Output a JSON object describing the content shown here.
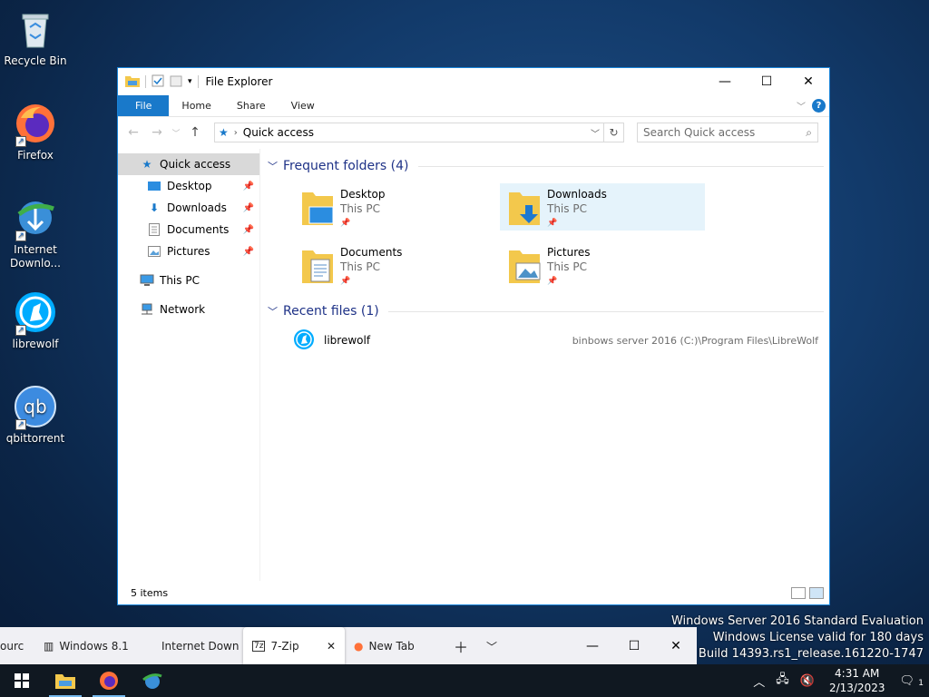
{
  "desktop": {
    "icons": [
      {
        "label": "Recycle Bin"
      },
      {
        "label": "Firefox"
      },
      {
        "label": "Internet Downlo..."
      },
      {
        "label": "librewolf"
      },
      {
        "label": "qbittorrent"
      }
    ]
  },
  "window": {
    "title": "File Explorer",
    "ribbon_tabs": [
      "File",
      "Home",
      "Share",
      "View"
    ],
    "help_label": "?",
    "address": "Quick access",
    "search_placeholder": "Search Quick access",
    "nav": [
      {
        "label": "Quick access",
        "selected": true
      },
      {
        "label": "Desktop",
        "pinned": true
      },
      {
        "label": "Downloads",
        "pinned": true
      },
      {
        "label": "Documents",
        "pinned": true
      },
      {
        "label": "Pictures",
        "pinned": true
      },
      {
        "label": "This PC"
      },
      {
        "label": "Network"
      }
    ],
    "frequent_header": "Frequent folders (4)",
    "folders": [
      {
        "name": "Desktop",
        "location": "This PC"
      },
      {
        "name": "Downloads",
        "location": "This PC",
        "selected": true
      },
      {
        "name": "Documents",
        "location": "This PC"
      },
      {
        "name": "Pictures",
        "location": "This PC"
      }
    ],
    "recent_header": "Recent files (1)",
    "recent_files": [
      {
        "name": "librewolf",
        "path": "binbows server 2016 (C:)\\Program Files\\LibreWolf"
      }
    ],
    "status": "5 items"
  },
  "watermark": {
    "line1": "Windows Server 2016 Standard Evaluation",
    "line2": "Windows License valid for 180 days",
    "line3": "Build 14393.rs1_release.161220-1747"
  },
  "firefox_strip": {
    "tabs": [
      {
        "label": "ourc"
      },
      {
        "label": "Windows 8.1"
      },
      {
        "label": "Internet Down"
      },
      {
        "label": "7-Zip",
        "active": true
      },
      {
        "label": "New Tab"
      }
    ]
  },
  "taskbar": {
    "time": "4:31 AM",
    "date": "2/13/2023",
    "notification_count": "1"
  },
  "colors": {
    "accent": "#1979ca",
    "selection": "#e5f3fb"
  }
}
